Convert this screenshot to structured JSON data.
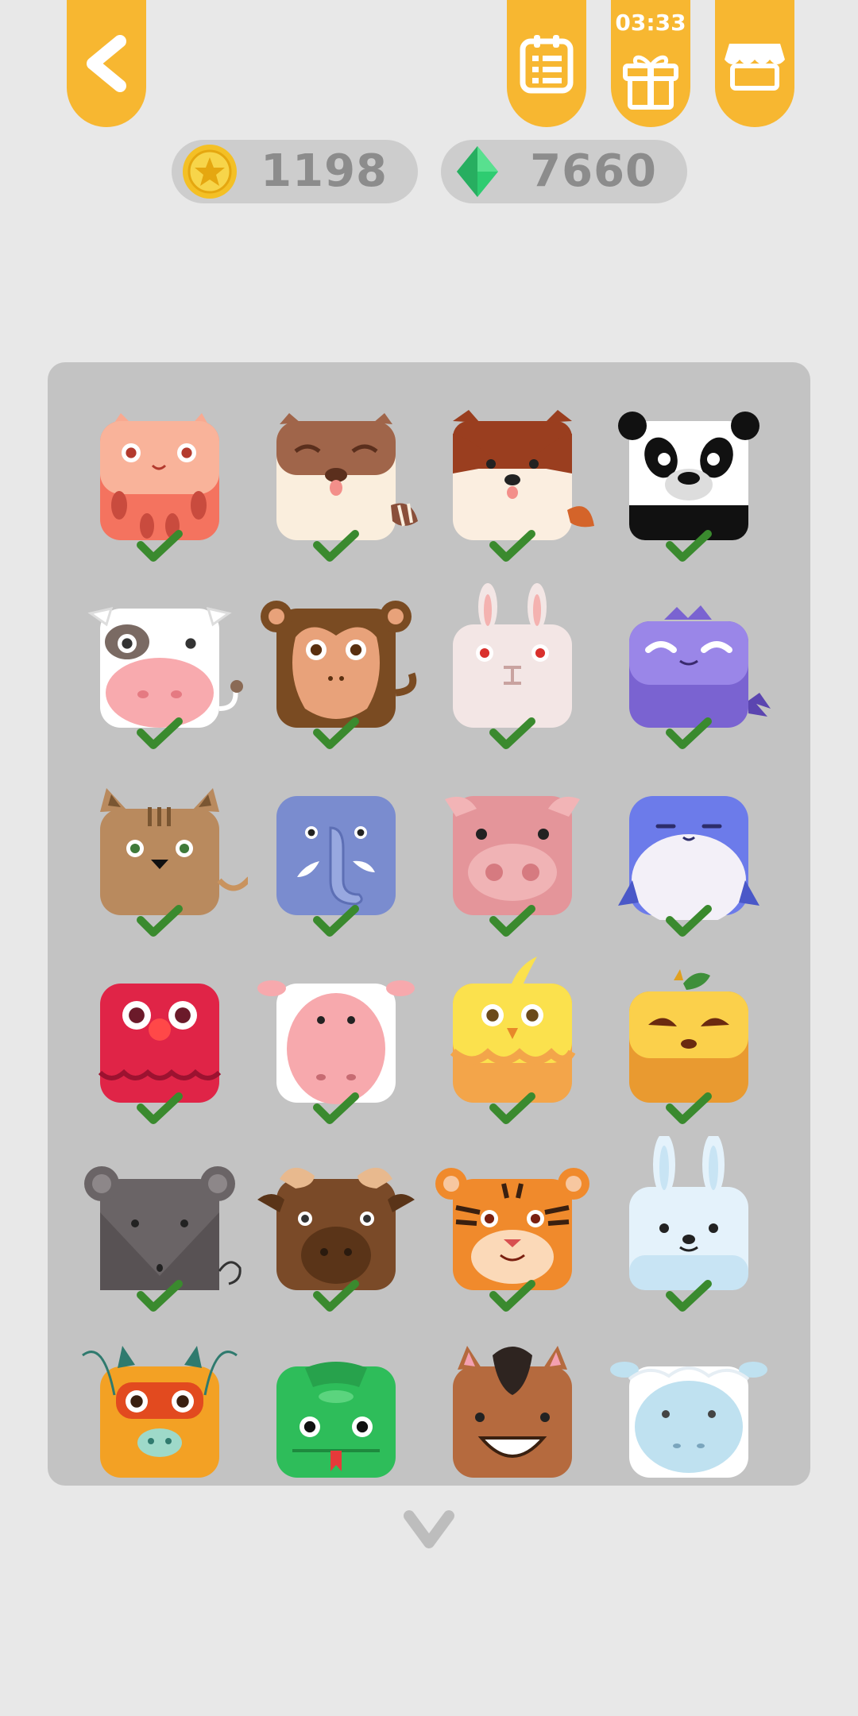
{
  "header": {
    "timer": "03:33"
  },
  "currency": {
    "coins": "1198",
    "gems": "7660"
  },
  "icons": {
    "back": "back-arrow-icon",
    "daily": "daily-tasks-icon",
    "gift": "gift-icon",
    "shop": "shop-icon",
    "coin": "star-coin-icon",
    "gem": "green-gem-icon",
    "scroll": "chevron-down-icon"
  },
  "colors": {
    "accent": "#f7b731",
    "check": "#3a8a2e",
    "panel": "#c3c3c3"
  },
  "characters": [
    {
      "id": "cat-pink",
      "owned": true
    },
    {
      "id": "raccoon",
      "owned": true
    },
    {
      "id": "fox",
      "owned": true
    },
    {
      "id": "panda",
      "owned": true
    },
    {
      "id": "cow",
      "owned": true
    },
    {
      "id": "monkey",
      "owned": true
    },
    {
      "id": "rabbit-white",
      "owned": true
    },
    {
      "id": "purple-dino",
      "owned": true
    },
    {
      "id": "tabby-cat",
      "owned": true
    },
    {
      "id": "elephant",
      "owned": true
    },
    {
      "id": "pig",
      "owned": true
    },
    {
      "id": "penguin",
      "owned": true
    },
    {
      "id": "red-bird",
      "owned": true
    },
    {
      "id": "sheep-pink",
      "owned": true
    },
    {
      "id": "chick",
      "owned": true
    },
    {
      "id": "pumpkin",
      "owned": true
    },
    {
      "id": "rat",
      "owned": true
    },
    {
      "id": "ox",
      "owned": true
    },
    {
      "id": "tiger",
      "owned": true
    },
    {
      "id": "snow-rabbit",
      "owned": true
    },
    {
      "id": "dragon",
      "owned": false
    },
    {
      "id": "snake",
      "owned": false
    },
    {
      "id": "horse",
      "owned": false
    },
    {
      "id": "goat",
      "owned": false
    }
  ]
}
